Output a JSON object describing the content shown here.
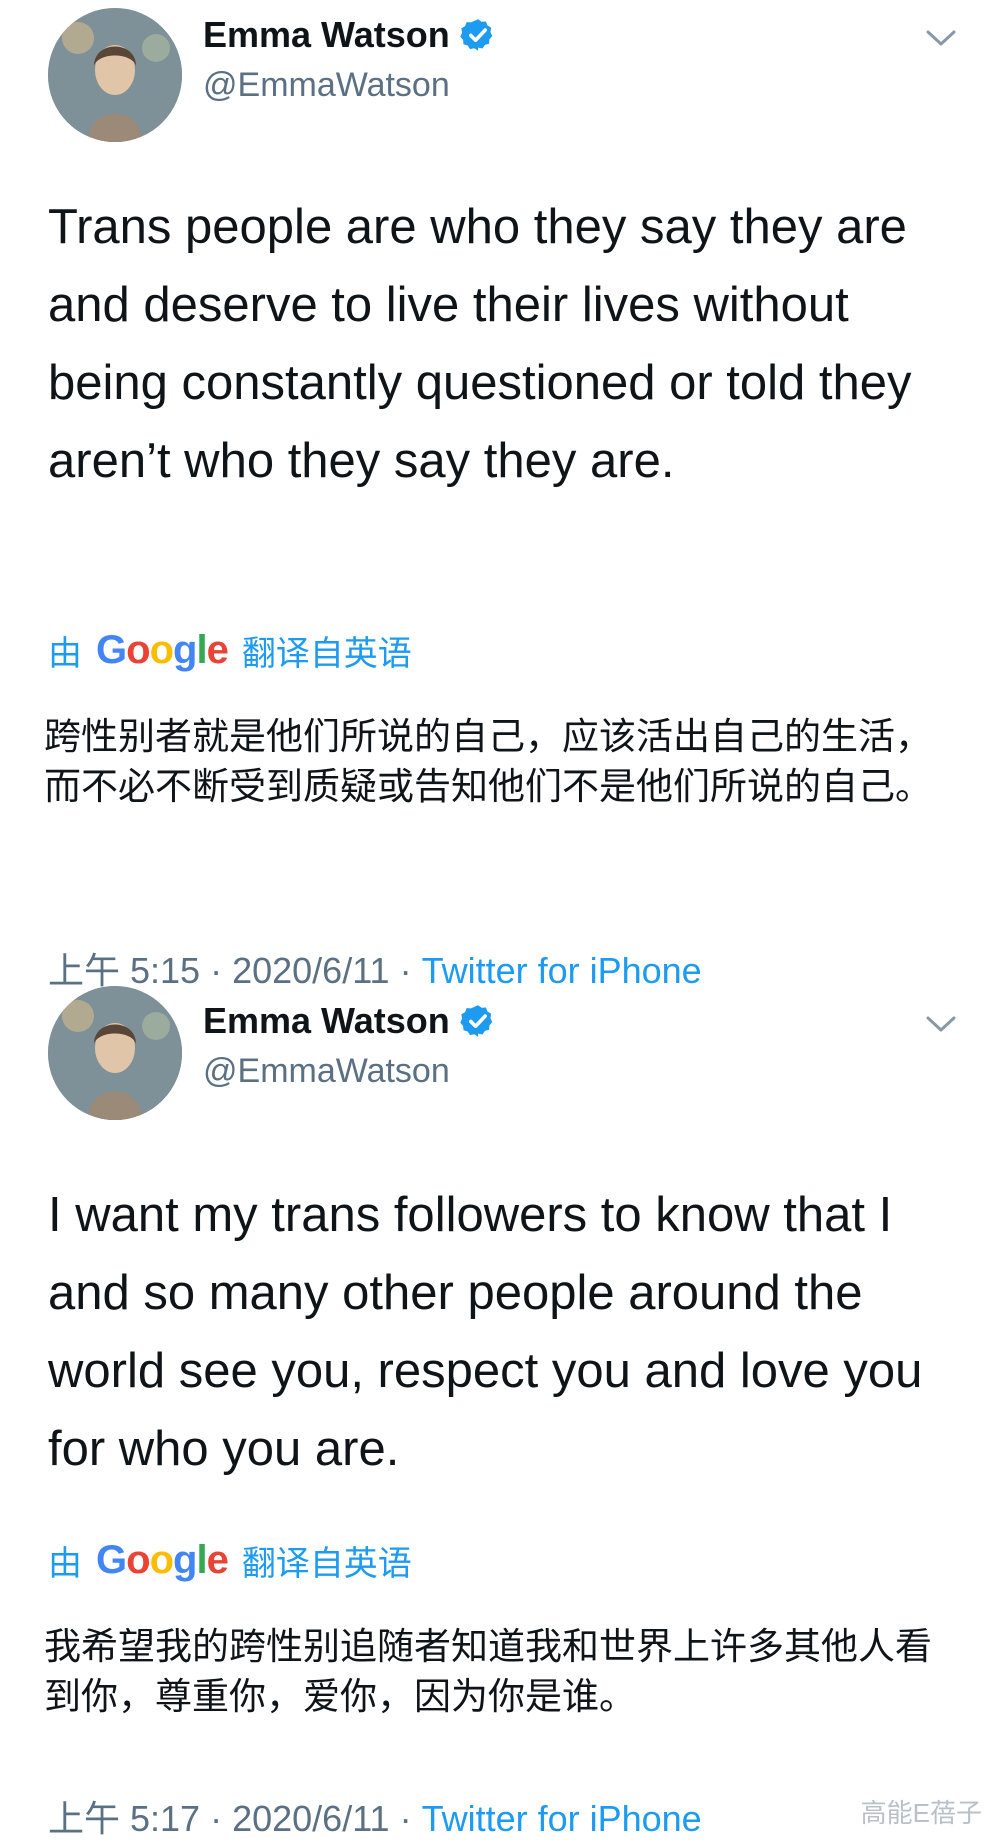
{
  "tweets": [
    {
      "display_name": "Emma Watson",
      "handle": "@EmmaWatson",
      "text": "Trans people are who they say they are and deserve to live their lives without being constantly questioned or told they aren’t who they say they are.",
      "translate_prefix": "由",
      "translate_suffix": "翻译自英语",
      "translation": "跨性别者就是他们所说的自己，应该活出自己的生活，而不必不断受到质疑或告知他们不是他们所说的自己。",
      "time": "上午 5:15",
      "date": "2020/6/11",
      "source": "Twitter for iPhone"
    },
    {
      "display_name": "Emma Watson",
      "handle": "@EmmaWatson",
      "text": "I want my trans followers to know that I and so many other people around the world see you, respect you and love you for who you are.",
      "translate_prefix": "由",
      "translate_suffix": "翻译自英语",
      "translation": "我希望我的跨性别追随者知道我和世界上许多其他人看到你，尊重你，爱你，因为你是谁。",
      "time": "上午 5:17",
      "date": "2020/6/11",
      "source": "Twitter for iPhone"
    }
  ],
  "google_logo": [
    "G",
    "o",
    "o",
    "g",
    "l",
    "e"
  ],
  "separator": " · ",
  "watermark": "高能E蓓子",
  "colors": {
    "link": "#1d9bf0",
    "secondary": "#5b7083",
    "verified": "#1d9bf0"
  },
  "icons": {
    "verified": "verified-badge-icon",
    "menu": "chevron-down-icon",
    "avatar": "profile-photo"
  }
}
